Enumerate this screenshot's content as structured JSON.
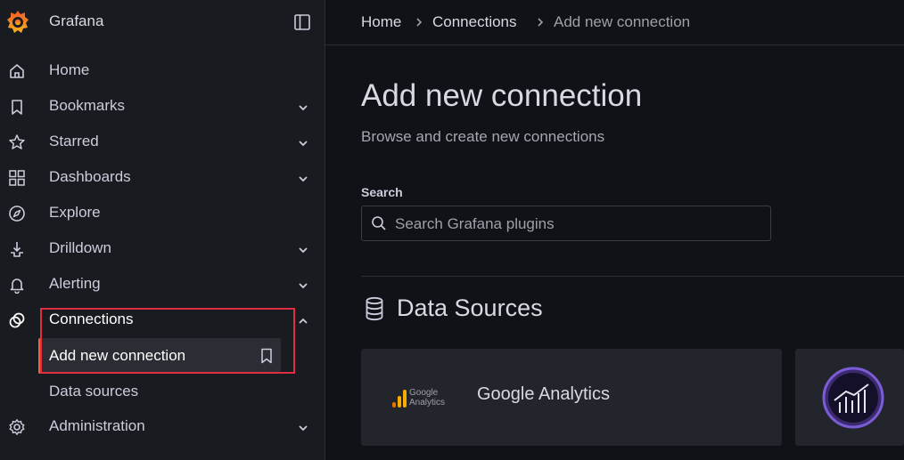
{
  "app": {
    "title": "Grafana"
  },
  "sidebar": {
    "items": [
      {
        "label": "Home"
      },
      {
        "label": "Bookmarks"
      },
      {
        "label": "Starred"
      },
      {
        "label": "Dashboards"
      },
      {
        "label": "Explore"
      },
      {
        "label": "Drilldown"
      },
      {
        "label": "Alerting"
      },
      {
        "label": "Connections"
      },
      {
        "label": "Administration"
      }
    ],
    "connections_children": [
      {
        "label": "Add new connection"
      },
      {
        "label": "Data sources"
      }
    ]
  },
  "breadcrumb": [
    "Home",
    "Connections",
    "Add new connection"
  ],
  "main": {
    "title": "Add new connection",
    "subtitle": "Browse and create new connections",
    "search": {
      "label": "Search",
      "placeholder": "Search Grafana plugins",
      "value": ""
    },
    "section_title": "Data Sources",
    "cards": [
      {
        "name": "Google Analytics",
        "logo_text_line1": "Google",
        "logo_text_line2": "Analytics"
      }
    ]
  },
  "colors": {
    "accent": "#f55f3e",
    "highlight_border": "#e02f44",
    "background": "#111217",
    "sidebar_bg": "#181b1f",
    "card_bg": "#22252b",
    "purple_logo": "#7b5cd6"
  }
}
